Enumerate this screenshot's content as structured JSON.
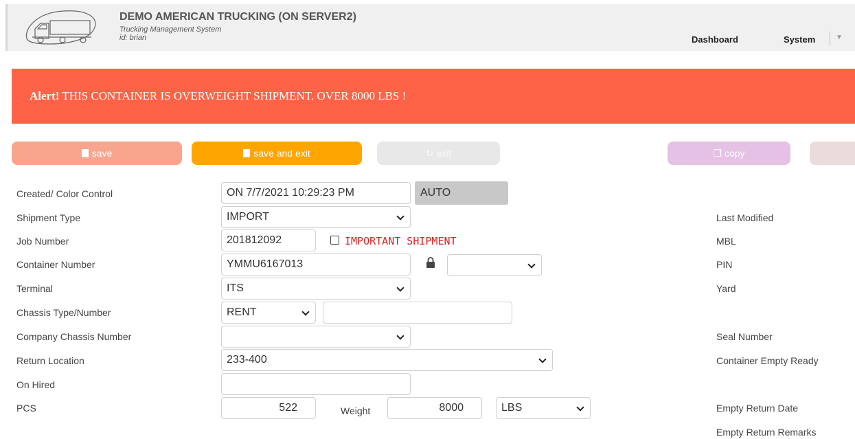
{
  "header": {
    "title": "DEMO AMERICAN TRUCKING (ON SERVER2)",
    "subtitle": "Trucking Management System",
    "user_id": "id: brian",
    "nav": {
      "dashboard": "Dashboard",
      "system": "System"
    },
    "icons": [
      "truck-logo",
      "caret-down-icon"
    ]
  },
  "alert": {
    "prefix": "Alert!",
    "message": "THIS CONTAINER IS OVERWEIGHT SHIPMENT. OVER 8000 LBS !",
    "color": "#ff6347"
  },
  "toolbar": {
    "save_label": "save",
    "save_exit_label": "save and exit",
    "exit_label": "exit",
    "copy_label": "copy",
    "delete_label": "×"
  },
  "form": {
    "created": {
      "label": "Created/ Color Control",
      "value": "ON 7/7/2021 10:29:23 PM",
      "color_control": "AUTO"
    },
    "shipment_type": {
      "label": "Shipment Type",
      "value": "IMPORT"
    },
    "job_number": {
      "label": "Job Number",
      "value": "201812092",
      "important_label": "IMPORTANT SHIPMENT",
      "important_checked": false
    },
    "container_number": {
      "label": "Container Number",
      "value": "YMMU6167013",
      "lock_select": ""
    },
    "terminal": {
      "label": "Terminal",
      "value": "ITS"
    },
    "chassis": {
      "label": "Chassis Type/Number",
      "type": "RENT",
      "number": ""
    },
    "company_chassis": {
      "label": "Company Chassis Number",
      "value": ""
    },
    "return_location": {
      "label": "Return Location",
      "value": "233-400"
    },
    "on_hired": {
      "label": "On Hired",
      "value": ""
    },
    "pcs": {
      "label": "PCS",
      "value": "522",
      "weight_label": "Weight",
      "weight": "8000",
      "unit": "LBS"
    }
  },
  "right_labels": {
    "last_modified": "Last Modified",
    "mbl": "MBL",
    "pin": "PIN",
    "yard": "Yard",
    "seal_number": "Seal Number",
    "container_empty_ready": "Container Empty Ready",
    "empty_return_date": "Empty Return Date",
    "empty_return_remarks": "Empty Return Remarks"
  }
}
